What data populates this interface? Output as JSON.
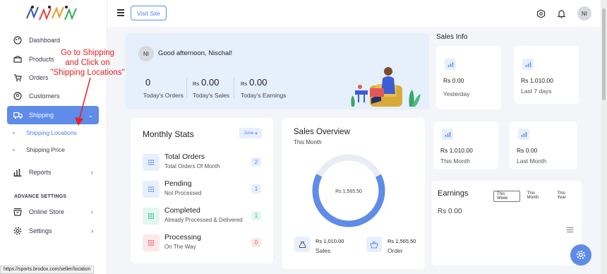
{
  "colors": {
    "accent": "#5f8be9",
    "annotation": "#e52222",
    "hero_bg": "#e6effc"
  },
  "sidebar": {
    "logo": "sports-logo",
    "items": [
      {
        "label": "Dashboard",
        "icon": "palette-icon"
      },
      {
        "label": "Products",
        "icon": "box-icon"
      },
      {
        "label": "Orders",
        "icon": "cart-icon"
      },
      {
        "label": "Customers",
        "icon": "user-circle-icon"
      },
      {
        "label": "Shipping",
        "icon": "truck-icon"
      }
    ],
    "sub_items": [
      "Shipping Locations",
      "Shipping Price"
    ],
    "reports_label": "Reports",
    "section_title": "ADVANCE SETTINGS",
    "online_store_label": "Online Store",
    "settings_label": "Settings"
  },
  "annotation": {
    "line1": "Go to Shipping",
    "line2": "and Click on",
    "line3": "\"Shipping Locations\""
  },
  "status_url": "https://sports.brodox.com/seller/location",
  "topbar": {
    "visit_label": "Visit Site",
    "avatar": "NI"
  },
  "hero": {
    "avatar": "NI",
    "greeting": "Good afternoon, Nischal!",
    "stats": [
      {
        "currency": "",
        "value": "0",
        "label": "Today's Orders"
      },
      {
        "currency": "Rs",
        "value": "0.00",
        "label": "Today's Sales"
      },
      {
        "currency": "Rs",
        "value": "0.00",
        "label": "Today's Earnings"
      }
    ]
  },
  "sales_info": {
    "title": "Sales Info",
    "cards": [
      {
        "value": "Rs 0.00",
        "label": "Yesterday"
      },
      {
        "value": "Rs 1,010.00",
        "label": "Last 7 days"
      },
      {
        "value": "Rs 1,010.00",
        "label": "This Month"
      },
      {
        "value": "Rs 0.00",
        "label": "Last Month"
      }
    ]
  },
  "monthly_stats": {
    "title": "Monthly Stats",
    "month": "June",
    "rows": [
      {
        "title": "Total Orders",
        "sub": "Total Orders Of Month",
        "count": "2"
      },
      {
        "title": "Pending",
        "sub": "Not Processed",
        "count": "1"
      },
      {
        "title": "Completed",
        "sub": "Already Processed & Delivered",
        "count": "1"
      },
      {
        "title": "Processing",
        "sub": "On The Way",
        "count": "0"
      }
    ]
  },
  "sales_overview": {
    "title": "Sales Overview",
    "subtitle": "This Month",
    "center_value": "Rs 1,565.50",
    "sales_value": "Rs 1,010.00",
    "sales_label": "Sales",
    "order_value": "Rs 1,565.50",
    "order_label": "Order",
    "ring_fill_fraction": 0.65
  },
  "earnings": {
    "title": "Earnings",
    "tabs": [
      "This Week",
      "This Month",
      "This Year"
    ],
    "active_tab": "This Week",
    "value": "Rs 0.00"
  }
}
